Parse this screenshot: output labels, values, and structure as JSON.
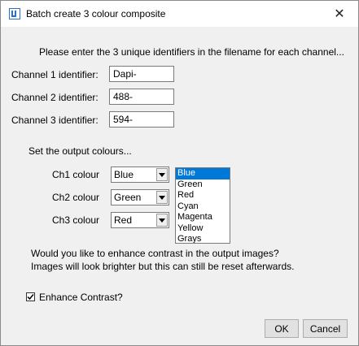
{
  "window": {
    "title": "Batch create 3 colour composite"
  },
  "prompt": "Please enter the 3 unique identifiers in the filename for each channel...",
  "channels": [
    {
      "label": "Channel 1 identifier:",
      "value": "Dapi-"
    },
    {
      "label": "Channel 2 identifier:",
      "value": "488-"
    },
    {
      "label": "Channel 3 identifier:",
      "value": "594-"
    }
  ],
  "output_heading": "Set the output colours...",
  "colour_selects": [
    {
      "label": "Ch1 colour",
      "value": "Blue"
    },
    {
      "label": "Ch2 colour",
      "value": "Green"
    },
    {
      "label": "Ch3 colour",
      "value": "Red"
    }
  ],
  "colour_options": [
    "Blue",
    "Green",
    "Red",
    "Cyan",
    "Magenta",
    "Yellow",
    "Grays"
  ],
  "selected_option": "Blue",
  "contrast_question_line1": "Would you like to enhance contrast in the output images?",
  "contrast_question_line2": "Images will look brighter but this can still be reset afterwards.",
  "enhance_contrast": {
    "label": "Enhance Contrast?",
    "checked": true
  },
  "buttons": {
    "ok": "OK",
    "cancel": "Cancel"
  },
  "icons": {
    "app": "imagej-icon",
    "close": "close-icon",
    "dropdown": "chevron-down-icon",
    "check": "checkmark-icon"
  }
}
